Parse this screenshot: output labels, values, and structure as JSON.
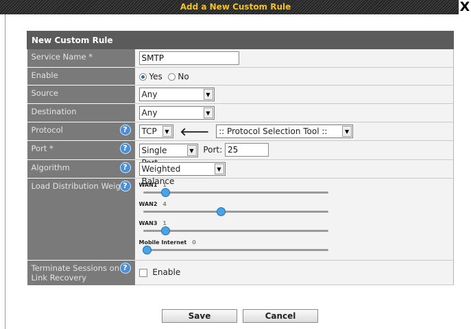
{
  "dialog": {
    "title": "Add a New Custom Rule",
    "close_label": "X"
  },
  "form": {
    "header": "New Custom Rule",
    "service_name": {
      "label": "Service Name *",
      "value": "SMTP"
    },
    "enable": {
      "label": "Enable",
      "yes_label": "Yes",
      "no_label": "No",
      "selected": "Yes"
    },
    "source": {
      "label": "Source",
      "value": "Any"
    },
    "destination": {
      "label": "Destination",
      "value": "Any"
    },
    "protocol": {
      "label": "Protocol",
      "value": "TCP",
      "tool_value": ":: Protocol Selection Tool ::"
    },
    "port": {
      "label": "Port *",
      "mode_value": "Single Port",
      "port_label": "Port:",
      "port_value": "25"
    },
    "algorithm": {
      "label": "Algorithm",
      "value": "Weighted Balance"
    },
    "load_distribution": {
      "label": "Load Distribution Weight",
      "wans": [
        {
          "name": "WAN1",
          "weight": "1",
          "level": 0.1
        },
        {
          "name": "WAN2",
          "weight": "4",
          "level": 0.4
        },
        {
          "name": "WAN3",
          "weight": "1",
          "level": 0.1
        },
        {
          "name": "Mobile Internet",
          "weight": "0",
          "level": 0.0
        }
      ]
    },
    "terminate": {
      "label": "Terminate Sessions on Link Recovery",
      "checkbox_label": "Enable"
    }
  },
  "buttons": {
    "save": "Save",
    "cancel": "Cancel"
  },
  "help_glyph": "?"
}
